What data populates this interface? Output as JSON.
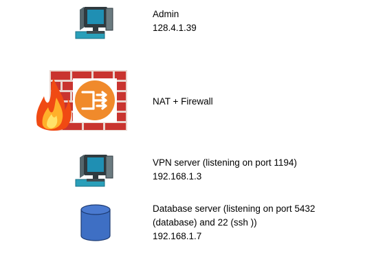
{
  "nodes": [
    {
      "id": "admin",
      "icon": "computer-icon",
      "lines": [
        "Admin",
        "128.4.1.39"
      ]
    },
    {
      "id": "nat_firewall",
      "icon": "firewall-nat-icon",
      "lines": [
        "NAT + Firewall"
      ]
    },
    {
      "id": "vpn_server",
      "icon": "computer-icon",
      "lines": [
        "VPN server (listening on port 1194)",
        "192.168.1.3"
      ]
    },
    {
      "id": "database_server",
      "icon": "database-icon",
      "lines": [
        "Database server (listening on port 5432",
        "(database) and 22 (ssh  ))",
        "192.168.1.7"
      ]
    }
  ],
  "colors": {
    "monitor_frame": "#2f3a3f",
    "screen": "#1f8fb3",
    "desk": "#2a9fb9",
    "brick": "#c9342f",
    "mortar": "#e9d5cf",
    "nat_orange": "#f08a2b",
    "flame_outer": "#f04a13",
    "flame_inner": "#ffd23a",
    "db_fill": "#3e6fc4",
    "db_stroke": "#1d3b72"
  }
}
